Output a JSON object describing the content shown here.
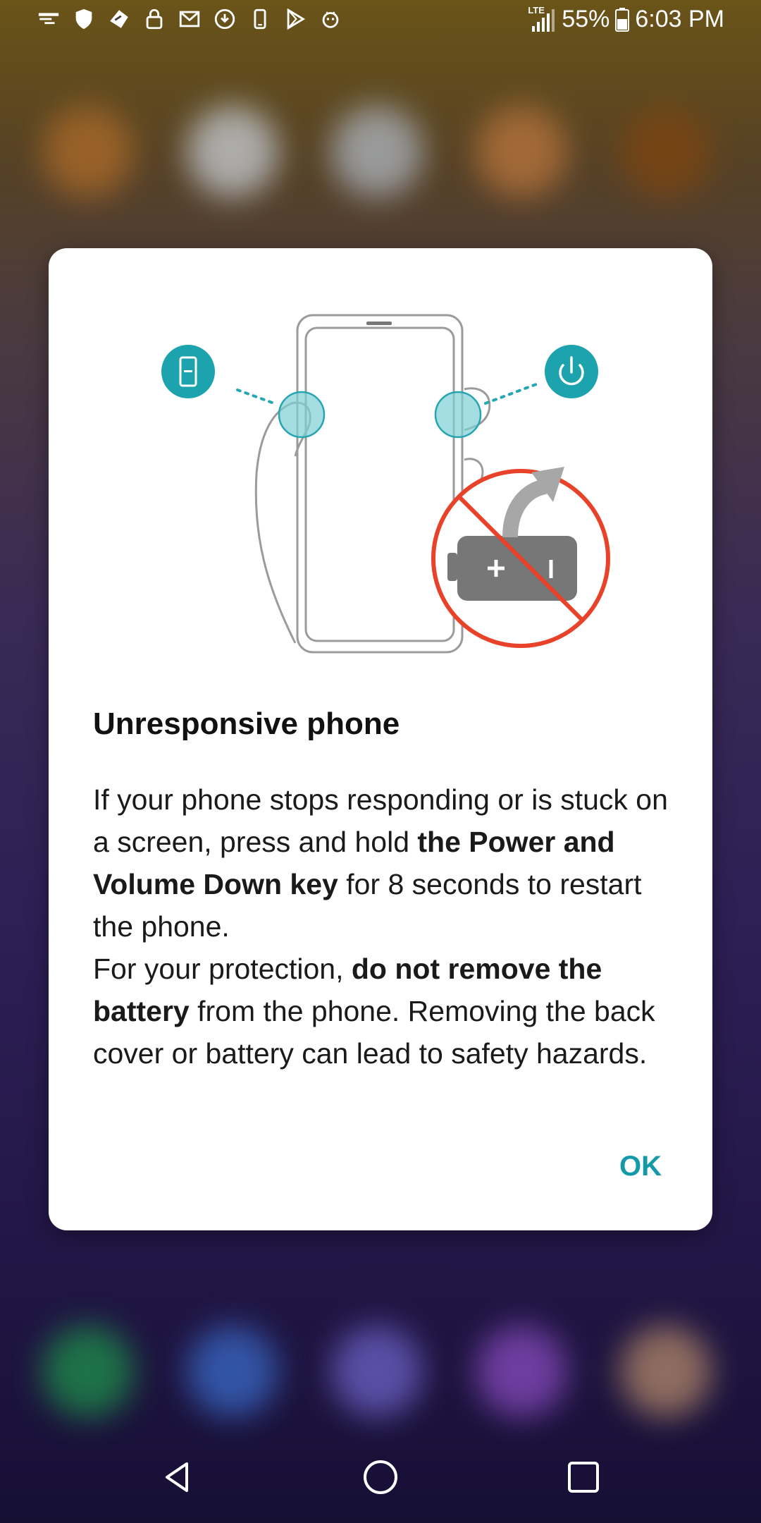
{
  "status_bar": {
    "network": "LTE",
    "battery_percent": "55%",
    "time": "6:03 PM",
    "notification_icons": [
      "cast-icon",
      "shield-icon",
      "bird-app-icon",
      "lock-icon",
      "gmail-icon",
      "download-icon",
      "phone-icon",
      "play-store-icon",
      "android-debug-icon"
    ]
  },
  "dialog": {
    "title": "Unresponsive phone",
    "body": {
      "p1_a": "If your phone stops responding or is stuck on a screen, press and hold ",
      "p1_b": "the Power and Volume Down key",
      "p1_c": " for 8 seconds to restart the phone.",
      "p2_a": "For your protection, ",
      "p2_b": "do not remove the battery",
      "p2_c": " from the phone. Removing the back cover or battery can lead to safety hazards."
    },
    "ok_label": "OK"
  },
  "colors": {
    "accent": "#1399a8",
    "warning": "#e8432a",
    "dialog_bg": "#ffffff"
  },
  "nav_bar": {
    "buttons": [
      "back-icon",
      "home-icon",
      "recents-icon"
    ]
  }
}
